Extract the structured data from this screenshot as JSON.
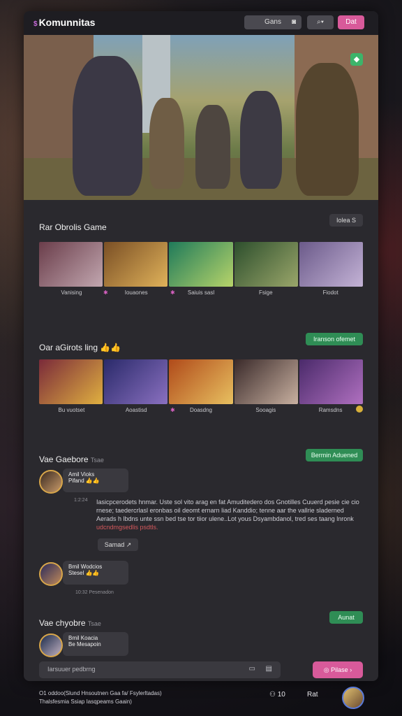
{
  "app": {
    "brand": "Komunnitas"
  },
  "topbar": {
    "search_label": "Gans",
    "search2_label": "Q",
    "action_label": "Dat"
  },
  "hero": {
    "badge": "◆"
  },
  "section1": {
    "title": "Rar Obrolis Game",
    "action": "Iolea S",
    "captions": [
      "Vanising",
      "Iouaones",
      "Saiuis sasl",
      "Fsige",
      "Fiodot"
    ]
  },
  "section2": {
    "title": "Oar aGirots ling 👍👍",
    "action": "Iranson ofemet",
    "captions": [
      "Bu vuotset",
      "Aoastisd",
      "Doasdng",
      "Sooagis",
      "Ramsdns"
    ]
  },
  "section3": {
    "title": "Vae Gaebore",
    "sub": "Tsae",
    "action": "Bermin Aduened",
    "post1": {
      "name": "Amil Vioks",
      "line": "Pifand 👍👍",
      "meta": "1:2:24",
      "text": "Iasicpcerodets hnmar. Uste sol vito arag en fat Amuditedero dos Gnotilles Cuuerd pesie cie cio rnese; taedercrlasl eronbas oil deomt ernarn liad Kanddio; tenne aar the vallrie sladerned Aerads h lbdns unte ssn bed tse tor tiior ulene..Lot yous Dsyambdanol, tred ses taang lnronk",
      "link": "udcndmgsedlis psdtls.",
      "action": "Samad"
    },
    "post2": {
      "name": "Bmil Wodcios",
      "line": "Stesel 👍👍",
      "meta": "10:32   Pesenadon"
    }
  },
  "section4": {
    "title": "Vae chyobre",
    "sub": "Tsae",
    "action": "Aunat",
    "post": {
      "name": "Bmil Koacia",
      "line": "Be Mesapoin"
    }
  },
  "composer": {
    "placeholder": "Iarsuuer pedbrng",
    "send": "Pilase"
  },
  "footer": {
    "line1": "O1 oddoo(Slund Hnsoutnen Gaa fa/ Fsylerltadas)",
    "line2": "Thalsfesmia Ssiap Iasqpeams Gaain)",
    "count": "10",
    "user": "Rat"
  },
  "colors": {
    "accent": "#d85a9a",
    "green": "#2f8d55",
    "panel": "#2a292e"
  }
}
